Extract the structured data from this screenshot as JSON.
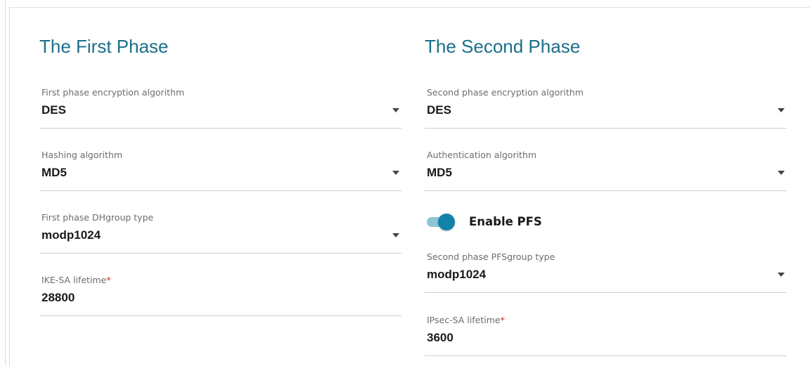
{
  "first_phase": {
    "title": "The First Phase",
    "encryption": {
      "label": "First phase encryption algorithm",
      "value": "DES"
    },
    "hashing": {
      "label": "Hashing algorithm",
      "value": "MD5"
    },
    "dhgroup": {
      "label": "First phase DHgroup type",
      "value": "modp1024"
    },
    "ike_lifetime": {
      "label": "IKE-SA lifetime",
      "required": "*",
      "value": "28800"
    }
  },
  "second_phase": {
    "title": "The Second Phase",
    "encryption": {
      "label": "Second phase encryption algorithm",
      "value": "DES"
    },
    "authentication": {
      "label": "Authentication algorithm",
      "value": "MD5"
    },
    "pfs": {
      "label": "Enable PFS",
      "enabled": true
    },
    "pfsgroup": {
      "label": "Second phase PFSgroup type",
      "value": "modp1024"
    },
    "ipsec_lifetime": {
      "label": "IPsec-SA lifetime",
      "required": "*",
      "value": "3600"
    }
  },
  "colors": {
    "title": "#1b6f8a",
    "toggle_on": "#1183a8",
    "required": "#d9262c"
  }
}
